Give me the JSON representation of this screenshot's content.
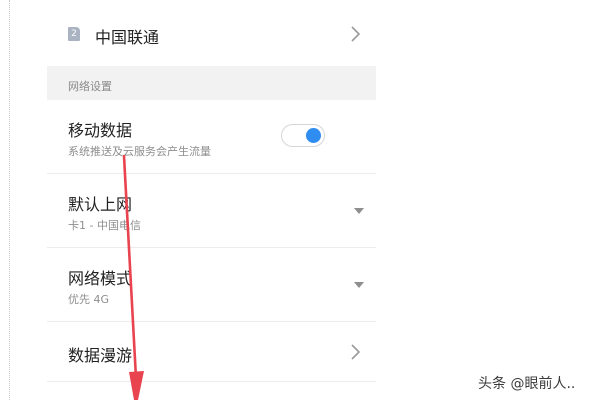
{
  "sim_card": {
    "badge": "2",
    "label": "中国联通"
  },
  "network_settings": {
    "section_title": "网络设置",
    "mobile_data": {
      "title": "移动数据",
      "subtitle": "系统推送及云服务会产生流量",
      "enabled": true
    },
    "default_internet": {
      "title": "默认上网",
      "value": "卡1 - 中国电信"
    },
    "network_mode": {
      "title": "网络模式",
      "value": "优先 4G"
    },
    "data_roaming": {
      "title": "数据漫游"
    }
  },
  "watermark": "头条 @眼前人..",
  "colors": {
    "toggle_on": "#2f8cf0",
    "annotation_arrow": "#e8434f",
    "section_bg": "#f2f2f2"
  },
  "icons": {
    "chevron": "chevron-right-icon",
    "dropdown": "caret-down-icon",
    "sim": "sim-card-icon"
  }
}
